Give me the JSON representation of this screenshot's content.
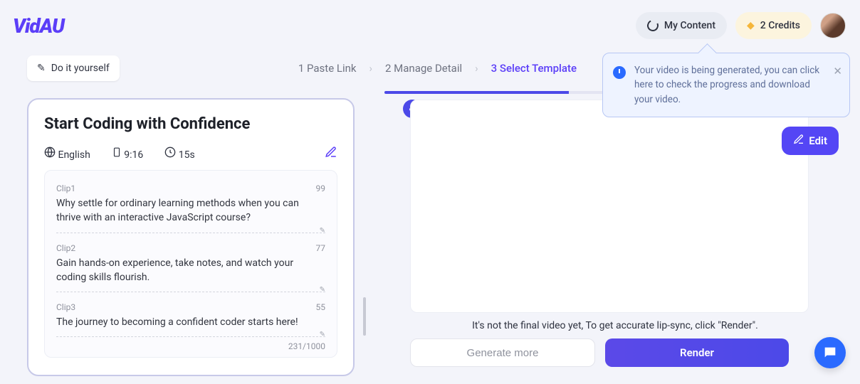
{
  "header": {
    "logo_text": "VidAU",
    "my_content_label": "My Content",
    "credits_label": "2 Credits"
  },
  "subheader": {
    "diy_label": "Do it yourself",
    "steps": {
      "step1": "1 Paste Link",
      "step2": "2 Manage Detail",
      "step3": "3 Select Template"
    }
  },
  "editor": {
    "title": "Start Coding with Confidence",
    "language": "English",
    "aspect": "9:16",
    "duration": "15s",
    "clips": [
      {
        "label": "Clip1",
        "remaining": "99",
        "text": "Why settle for ordinary learning methods when you can thrive with an interactive JavaScript course?"
      },
      {
        "label": "Clip2",
        "remaining": "77",
        "text": " Gain hands-on experience, take notes, and watch your coding skills flourish."
      },
      {
        "label": "Clip3",
        "remaining": "55",
        "text": " The journey to becoming a confident coder starts here!"
      }
    ],
    "counter": "231/1000"
  },
  "preview": {
    "hint": "It's not the final video yet, To get accurate lip-sync, click \"Render\".",
    "generate_label": "Generate more",
    "render_label": "Render",
    "edit_label": "Edit"
  },
  "toast": {
    "text": "Your video is being generated, you can click here to check the progress and download your video."
  },
  "icons": {
    "globe": "🌐",
    "phone": "📱",
    "clock": "🕒",
    "pen": "✎",
    "check": "✓",
    "diamond": "◆"
  }
}
